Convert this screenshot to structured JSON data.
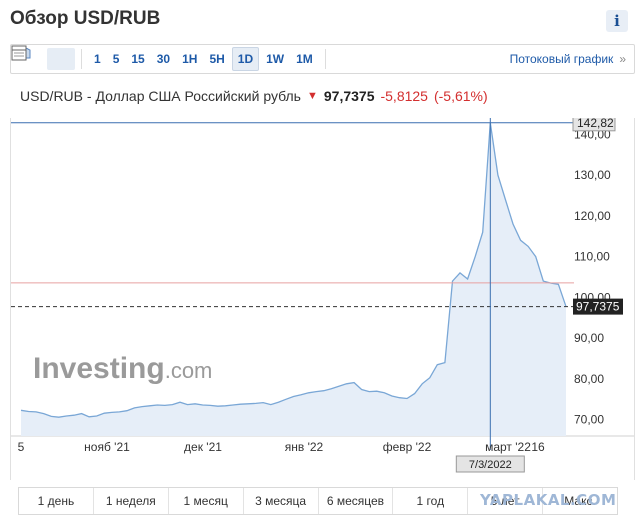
{
  "header": {
    "title": "Обзор USD/RUB",
    "info_icon": "info-icon",
    "info_label": "i"
  },
  "toolbar": {
    "icons": [
      "candlestick-icon",
      "area-chart-icon",
      "table-icon"
    ],
    "timeframes": [
      "1",
      "5",
      "15",
      "30",
      "1H",
      "5H",
      "1D",
      "1W",
      "1M"
    ],
    "active_timeframe": "1D",
    "stream_label": "Потоковый график",
    "stream_chevron": "»"
  },
  "quote": {
    "name": "USD/RUB - Доллар США Российский рубль",
    "price": "97,7375",
    "change": "-5,8125",
    "change_pct": "(-5,61%)",
    "down_color": "#d32f2f"
  },
  "chart_data": {
    "type": "area",
    "title": "",
    "xlabel": "",
    "ylabel": "",
    "ylim": [
      66,
      144
    ],
    "y_ticks": [
      "140,00",
      "130,00",
      "120,00",
      "110,00",
      "100,00",
      "90,00",
      "80,00",
      "70,00"
    ],
    "x_tick_labels": [
      "5",
      "нояб '21",
      "дек '21",
      "янв '22",
      "февр '22",
      "март '22",
      "16"
    ],
    "line_color": "#7aa7d6",
    "fill_color": "#e6eef8",
    "series": [
      {
        "values": [
          72.3,
          72.0,
          71.9,
          71.5,
          70.8,
          70.6,
          70.9,
          71.1,
          71.5,
          70.7,
          70.9,
          71.6,
          71.8,
          71.9,
          72.2,
          72.9,
          73.2,
          73.4,
          73.6,
          73.5,
          73.7,
          74.3,
          73.7,
          73.9,
          73.6,
          73.5,
          73.3,
          73.4,
          73.6,
          73.8,
          73.9,
          74.0,
          74.2,
          73.7,
          74.3,
          75.0,
          75.7,
          76.1,
          76.6,
          76.9,
          77.1,
          77.6,
          78.2,
          78.8,
          79.1,
          77.4,
          76.9,
          77.0,
          76.6,
          75.8,
          75.4,
          75.2,
          76.4,
          78.8,
          80.3,
          83.5,
          84.0,
          104.0,
          106.0,
          104.5,
          110.0,
          116.0,
          142.82,
          130.0,
          124.0,
          118.0,
          114.0,
          112.5,
          110.0,
          104.0,
          103.5,
          103.2,
          97.7375
        ]
      }
    ],
    "reference_lines": {
      "crosshair_value": "142,82",
      "previous_close": 103.55,
      "last_value": "97,7375"
    },
    "crosshair_date": "7/3/2022"
  },
  "periods": [
    "1 день",
    "1 неделя",
    "1 месяц",
    "3 месяца",
    "6 месяцев",
    "1 год",
    "5 лет",
    "Макс."
  ],
  "brand": {
    "logo_main": "Investing",
    "logo_suffix": ".com"
  },
  "watermark": "YAPLAKAL.COM"
}
